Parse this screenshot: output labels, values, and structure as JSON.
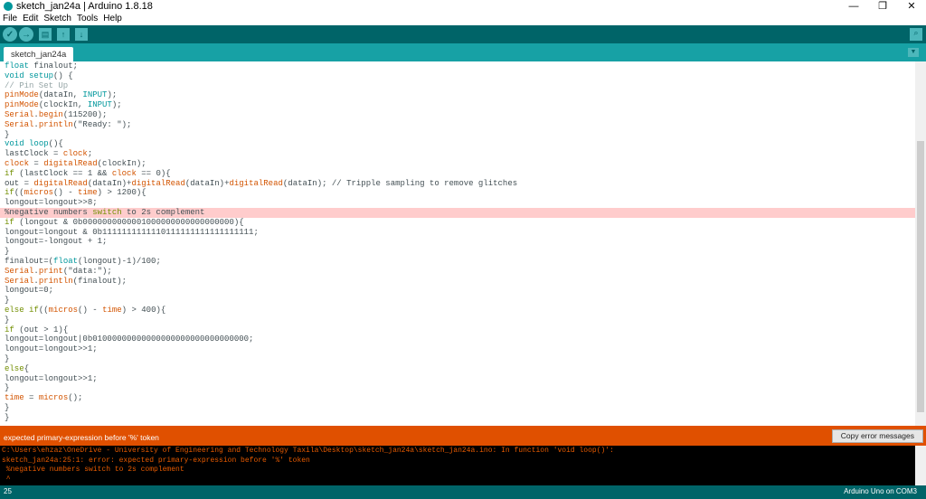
{
  "window": {
    "title": "sketch_jan24a | Arduino 1.8.18",
    "minimize": "—",
    "maximize": "❐",
    "close": "✕"
  },
  "menu": [
    "File",
    "Edit",
    "Sketch",
    "Tools",
    "Help"
  ],
  "toolbar": {
    "verify": "✓",
    "upload": "→",
    "new": "▤",
    "open": "↑",
    "save": "↓",
    "serial_monitor": "⌕"
  },
  "tab": {
    "label": "sketch_jan24a",
    "menu": "▼"
  },
  "code_lines": [
    [
      [
        "float",
        "kw"
      ],
      [
        " finalout;",
        ""
      ]
    ],
    [
      [
        "void",
        "kw"
      ],
      [
        " ",
        ""
      ],
      [
        "setup",
        "kw"
      ],
      [
        "() {",
        ""
      ]
    ],
    [
      [
        "// Pin Set Up",
        "cm"
      ]
    ],
    [
      [
        "pinMode",
        "fn"
      ],
      [
        "(dataIn, ",
        ""
      ],
      [
        "INPUT",
        "kw"
      ],
      [
        ");",
        ""
      ]
    ],
    [
      [
        "pinMode",
        "fn"
      ],
      [
        "(clockIn, ",
        ""
      ],
      [
        "INPUT",
        "kw"
      ],
      [
        ");",
        ""
      ]
    ],
    [
      [
        "Serial",
        "fn"
      ],
      [
        ".",
        ""
      ],
      [
        "begin",
        "fn"
      ],
      [
        "(115200);",
        ""
      ]
    ],
    [
      [
        "Serial",
        "fn"
      ],
      [
        ".",
        ""
      ],
      [
        "println",
        "fn"
      ],
      [
        "(\"Ready: \");",
        ""
      ]
    ],
    [
      [
        "}",
        ""
      ]
    ],
    [
      [
        "void",
        "kw"
      ],
      [
        " ",
        ""
      ],
      [
        "loop",
        "kw"
      ],
      [
        "(){",
        ""
      ]
    ],
    [
      [
        "lastClock = ",
        ""
      ],
      [
        "clock",
        "fn"
      ],
      [
        ";",
        ""
      ]
    ],
    [
      [
        "clock",
        "fn"
      ],
      [
        " = ",
        ""
      ],
      [
        "digitalRead",
        "fn"
      ],
      [
        "(clockIn);",
        ""
      ]
    ],
    [
      [
        "if",
        "ct"
      ],
      [
        " (lastClock == 1 && ",
        ""
      ],
      [
        "clock",
        "fn"
      ],
      [
        " == 0){",
        ""
      ]
    ],
    [
      [
        "out = ",
        ""
      ],
      [
        "digitalRead",
        "fn"
      ],
      [
        "(dataIn)+",
        ""
      ],
      [
        "digitalRead",
        "fn"
      ],
      [
        "(dataIn)+",
        ""
      ],
      [
        "digitalRead",
        "fn"
      ],
      [
        "(dataIn); // Tripple sampling to remove glitches",
        ""
      ]
    ],
    [
      [
        "if",
        "ct"
      ],
      [
        "((",
        ""
      ],
      [
        "micros",
        "fn"
      ],
      [
        "() - ",
        ""
      ],
      [
        "time",
        "fn"
      ],
      [
        ") > 1200){",
        ""
      ]
    ],
    [
      [
        "longout=longout>>8;",
        ""
      ]
    ],
    [
      [
        "%negative numbers ",
        ""
      ],
      [
        "switch",
        "ct"
      ],
      [
        " to 2s complement",
        ""
      ]
    ],
    [
      [
        "if",
        "ct"
      ],
      [
        " (longout & 0b0000000000001000000000000000000){",
        ""
      ]
    ],
    [
      [
        "longout=longout & 0b1111111111110111111111111111111;",
        ""
      ]
    ],
    [
      [
        "longout=-longout + 1;",
        ""
      ]
    ],
    [
      [
        "}",
        ""
      ]
    ],
    [
      [
        "finalout=(",
        ""
      ],
      [
        "float",
        "kw"
      ],
      [
        "(longout)-1)/100;",
        ""
      ]
    ],
    [
      [
        "Serial",
        "fn"
      ],
      [
        ".",
        ""
      ],
      [
        "print",
        "fn"
      ],
      [
        "(\"data:\");",
        ""
      ]
    ],
    [
      [
        "Serial",
        "fn"
      ],
      [
        ".",
        ""
      ],
      [
        "println",
        "fn"
      ],
      [
        "(finalout);",
        ""
      ]
    ],
    [
      [
        "longout=0;",
        ""
      ]
    ],
    [
      [
        "}",
        ""
      ]
    ],
    [
      [
        "else",
        "ct"
      ],
      [
        " ",
        ""
      ],
      [
        "if",
        "ct"
      ],
      [
        "((",
        ""
      ],
      [
        "micros",
        "fn"
      ],
      [
        "() - ",
        ""
      ],
      [
        "time",
        "fn"
      ],
      [
        ") > 400){",
        ""
      ]
    ],
    [
      [
        "}",
        ""
      ]
    ],
    [
      [
        "if",
        "ct"
      ],
      [
        " (out > 1){",
        ""
      ]
    ],
    [
      [
        "longout=longout|0b01000000000000000000000000000000;",
        ""
      ]
    ],
    [
      [
        "longout=longout>>1;",
        ""
      ]
    ],
    [
      [
        "}",
        ""
      ]
    ],
    [
      [
        "else",
        "ct"
      ],
      [
        "{",
        ""
      ]
    ],
    [
      [
        "longout=longout>>1;",
        ""
      ]
    ],
    [
      [
        "}",
        ""
      ]
    ],
    [
      [
        "time",
        "fn"
      ],
      [
        " = ",
        ""
      ],
      [
        "micros",
        "fn"
      ],
      [
        "();",
        ""
      ]
    ],
    [
      [
        "}",
        ""
      ]
    ],
    [
      [
        "}",
        ""
      ]
    ]
  ],
  "error_line_index": 15,
  "error_bar": {
    "message": "expected primary-expression before '%' token",
    "copy_button": "Copy error messages"
  },
  "console": [
    "C:\\Users\\ehzaz\\OneDrive - University of Engineering and Technology Taxila\\Desktop\\sketch_jan24a\\sketch_jan24a.ino: In function 'void loop()':",
    "sketch_jan24a:25:1: error: expected primary-expression before '%' token",
    " %negative numbers switch to 2s complement",
    " ^"
  ],
  "status": {
    "line": "25",
    "board": "Arduino Uno on COM3"
  }
}
